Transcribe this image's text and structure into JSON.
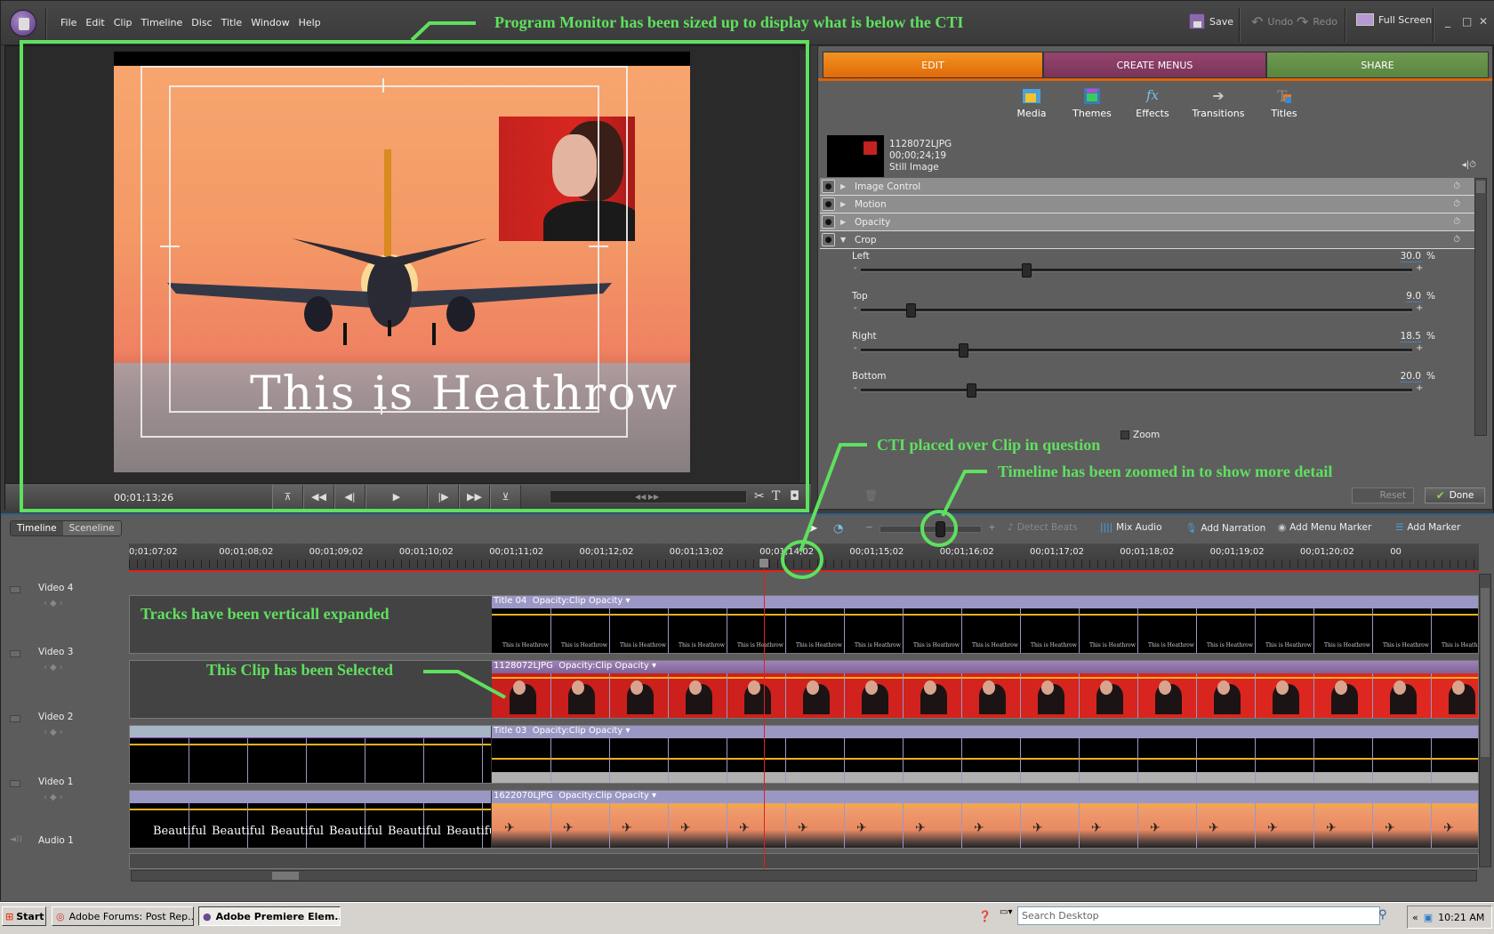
{
  "window": {
    "menus": [
      "File",
      "Edit",
      "Clip",
      "Timeline",
      "Disc",
      "Title",
      "Window",
      "Help"
    ],
    "toolbar": {
      "save": "Save",
      "undo": "Undo",
      "redo": "Redo",
      "full_screen": "Full Screen"
    },
    "window_controls": {
      "minimize": "_",
      "maximize": "□",
      "close": "✕"
    }
  },
  "monitor": {
    "overlay_title": "This is Heathrow",
    "timecode": "00;01;13;26",
    "transport_icons": [
      "go-to-previous-edit-icon",
      "rewind-icon",
      "step-back-icon",
      "play-icon",
      "step-forward-icon",
      "fast-forward-icon",
      "go-to-next-edit-icon"
    ],
    "tools": {
      "split": "✂",
      "title": "T",
      "freeze": "◘"
    }
  },
  "tasks_panel": {
    "tabs": [
      {
        "label": "EDIT",
        "color": "#ea7d14"
      },
      {
        "label": "CREATE MENUS",
        "color": "#8a3d65"
      },
      {
        "label": "SHARE",
        "color": "#64904a"
      }
    ],
    "tools": [
      "Media",
      "Themes",
      "Effects",
      "Transitions",
      "Titles"
    ],
    "clip": {
      "name": "1128072LJPG",
      "duration": "00;00;24;19",
      "type": "Still Image"
    },
    "effects": [
      {
        "label": "Image Control",
        "expanded": false
      },
      {
        "label": "Motion",
        "expanded": false
      },
      {
        "label": "Opacity",
        "expanded": false
      },
      {
        "label": "Crop",
        "expanded": true
      }
    ],
    "crop_params": [
      {
        "label": "Left",
        "value": "30.0",
        "unit": "%",
        "fraction": 0.3
      },
      {
        "label": "Top",
        "value": "9.0",
        "unit": "%",
        "fraction": 0.09
      },
      {
        "label": "Right",
        "value": "18.5",
        "unit": "%",
        "fraction": 0.185
      },
      {
        "label": "Bottom",
        "value": "20.0",
        "unit": "%",
        "fraction": 0.2
      }
    ],
    "zoom_checkbox": "Zoom",
    "reset": "Reset",
    "done": "Done"
  },
  "timeline": {
    "tabs": [
      "Timeline",
      "Sceneline"
    ],
    "zoom_level": 0.55,
    "toolbar": {
      "detect_beats": "Detect Beats",
      "mix_audio": "Mix Audio",
      "add_narration": "Add Narration",
      "add_menu_marker": "Add Menu Marker",
      "add_marker": "Add Marker"
    },
    "ruler_labels": [
      "0;01;07;02",
      "00;01;08;02",
      "00;01;09;02",
      "00;01;10;02",
      "00;01;11;02",
      "00;01;12;02",
      "00;01;13;02",
      "00;01;14;02",
      "00;01;15;02",
      "00;01;16;02",
      "00;01;17;02",
      "00;01;18;02",
      "00;01;19;02",
      "00;01;20;02",
      "00"
    ],
    "tracks": [
      {
        "name": "Video 4",
        "clip": "Title 04",
        "property": "Opacity:Clip Opacity",
        "frame_text": "This is Heathrow"
      },
      {
        "name": "Video 3",
        "clip": "1128072LJPG",
        "property": "Opacity:Clip Opacity",
        "selected": true
      },
      {
        "name": "Video 2",
        "clip": "Title 03",
        "property": "Opacity:Clip Opacity"
      },
      {
        "name": "Video 1",
        "clip": "1622070LJPG",
        "property": "Opacity:Clip Opacity",
        "prev_frame_text": "Beautiful"
      },
      {
        "name": "Audio 1"
      }
    ]
  },
  "annotations": {
    "monitor": "Program Monitor has been sized up to display what is below the CTI",
    "cti": "CTI placed over Clip in question",
    "zoom": "Timeline has been zoomed in to show more detail",
    "tracks": "Tracks have been verticall expanded",
    "selected": "This Clip has been Selected"
  },
  "taskbar": {
    "start": "Start",
    "tasks": [
      {
        "label": "Adobe Forums: Post Rep...",
        "active": false
      },
      {
        "label": "Adobe Premiere Elem...",
        "active": true
      }
    ],
    "search_placeholder": "Search Desktop",
    "clock": "10:21 AM"
  }
}
